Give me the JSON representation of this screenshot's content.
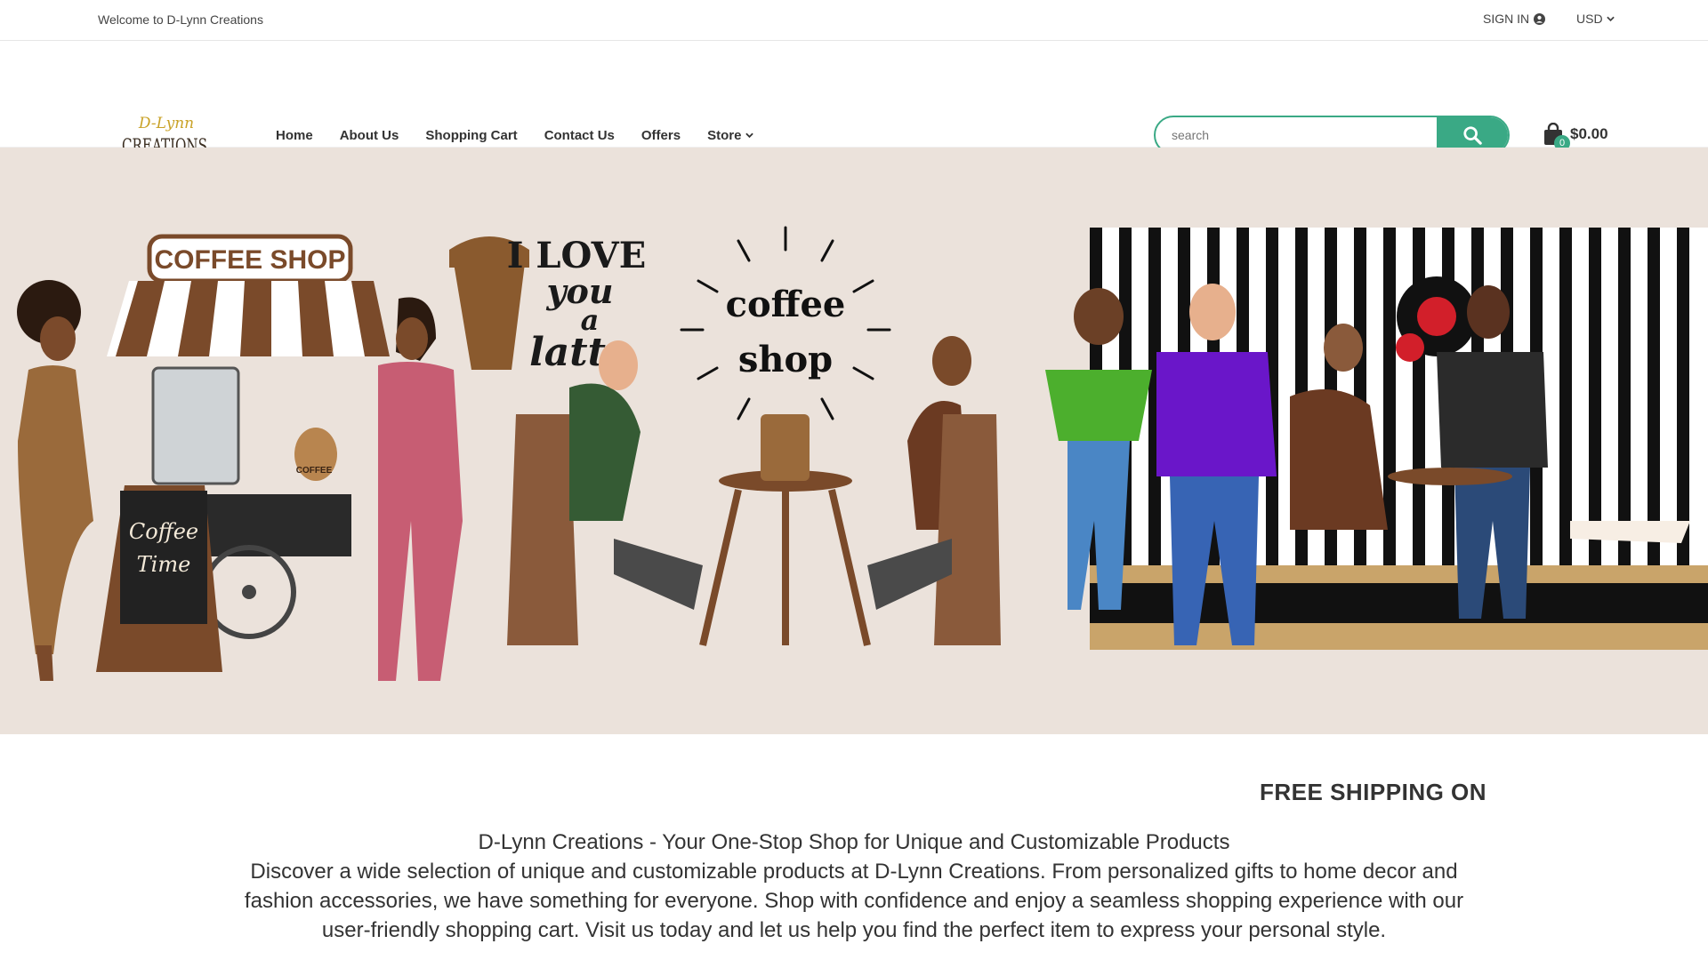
{
  "topbar": {
    "welcome": "Welcome to D-Lynn Creations",
    "signin_label": "SIGN IN",
    "currency": "USD"
  },
  "header": {
    "logo_text_top": "D-Lynn",
    "logo_text_bottom": "CREATIONS",
    "nav": [
      "Home",
      "About Us",
      "Shopping Cart",
      "Contact Us",
      "Offers",
      "Store"
    ],
    "search_placeholder": "search",
    "cart_count": "0",
    "cart_total": "$0.00"
  },
  "hero": {
    "coffee_shop_sign": "COFFEE SHOP",
    "chalkboard_line1": "Coffee",
    "chalkboard_line2": "Time",
    "love_line1": "I LOVE",
    "love_line2": "you",
    "love_line3": "a",
    "love_line4": "latte",
    "center_line1": "coffee",
    "center_line2": "shop",
    "bag_label": "COFFEE"
  },
  "promo": {
    "shipping_banner": "FREE SHIPPING ON"
  },
  "content": {
    "heading": "D-Lynn Creations - Your One-Stop Shop for Unique and Customizable Products",
    "body": "Discover a wide selection of unique and customizable products at D-Lynn Creations. From personalized gifts to home decor and fashion accessories, we have something for everyone. Shop with confidence and enjoy a seamless shopping experience with our user-friendly shopping cart. Visit us today and let us help you find the perfect item to express your personal style."
  },
  "colors": {
    "accent": "#3aa985",
    "hero_bg": "#ebe2db",
    "brown": "#7a4a2a"
  }
}
